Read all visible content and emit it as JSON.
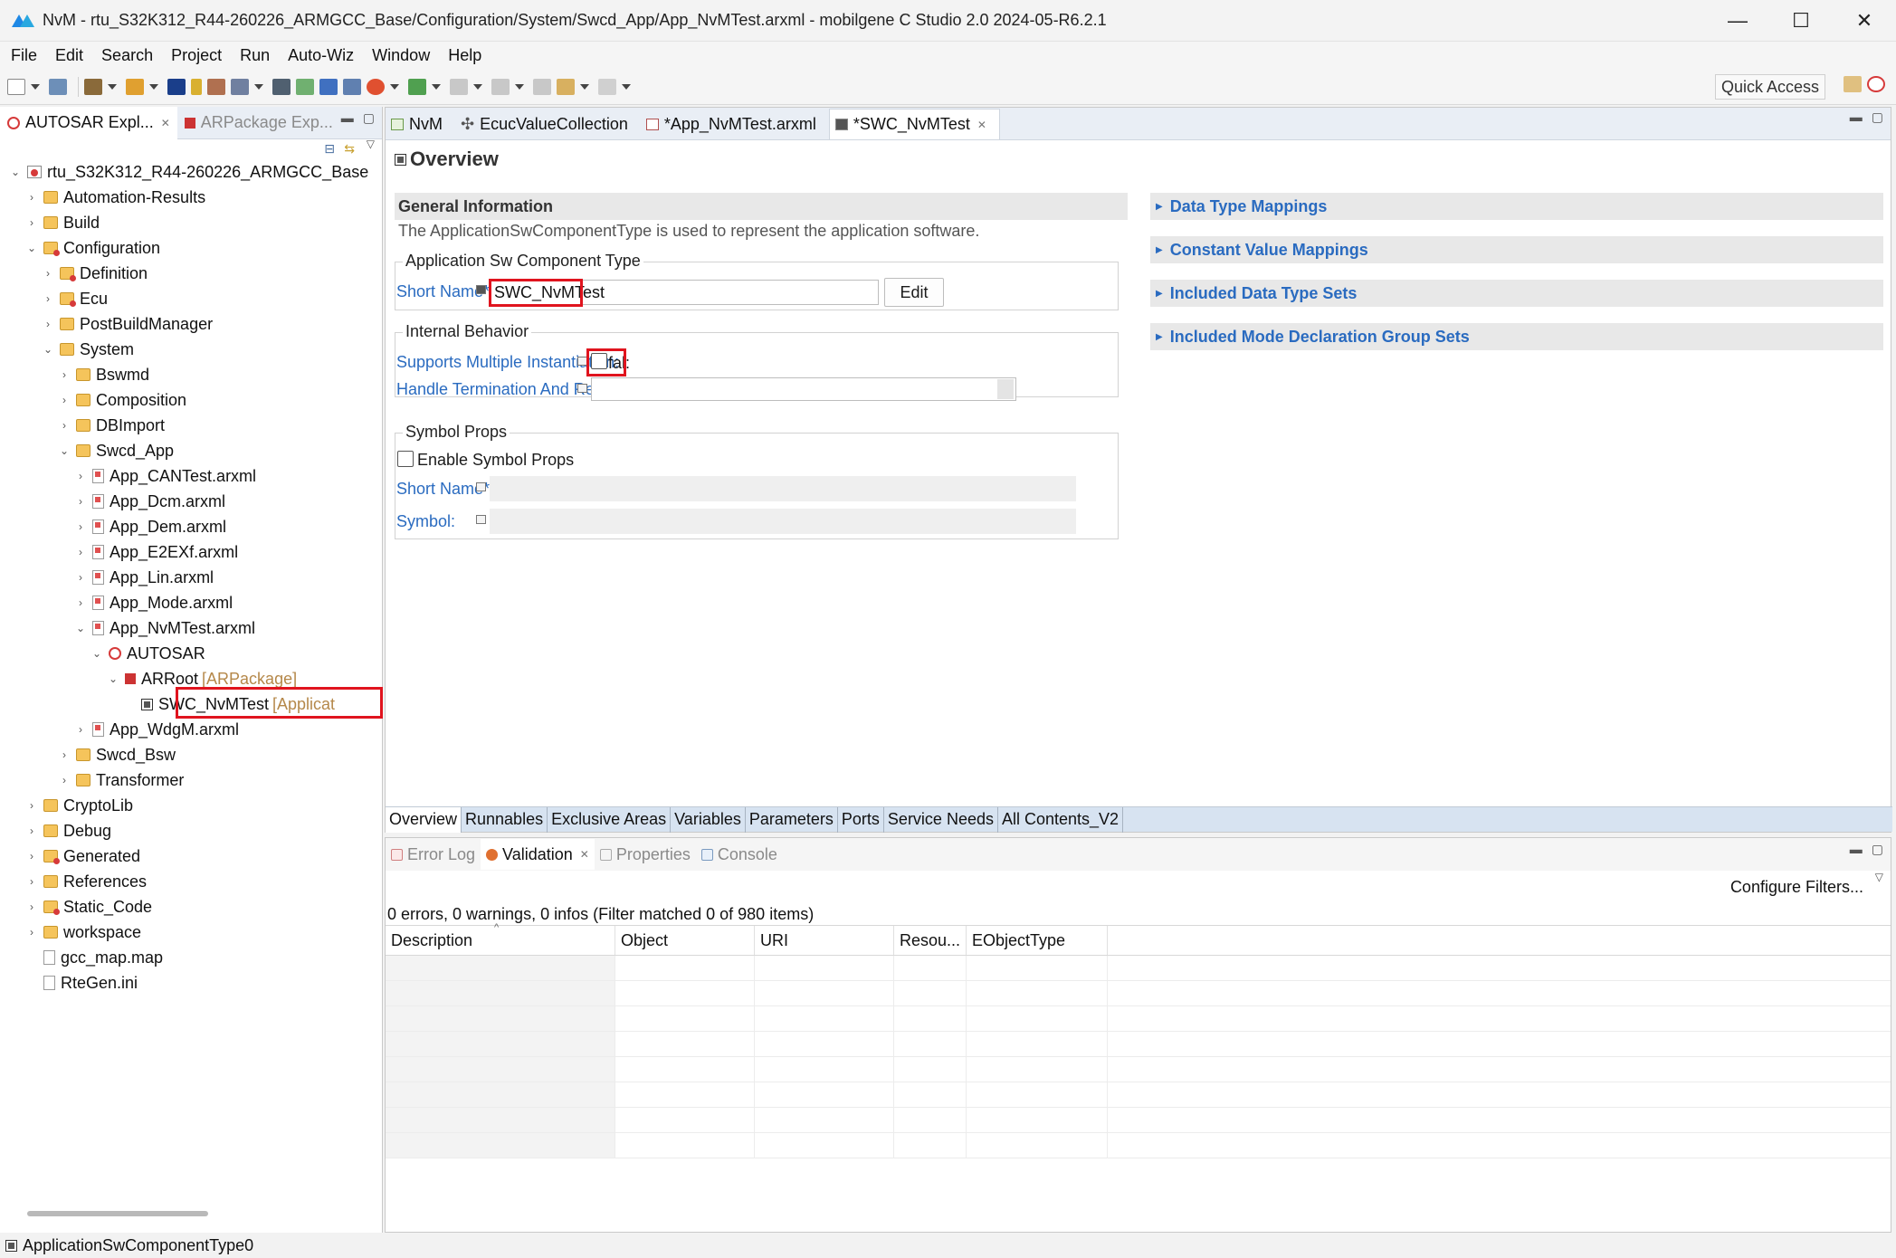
{
  "window": {
    "title": "NvM - rtu_S32K312_R44-260226_ARMGCC_Base/Configuration/System/Swcd_App/App_NvMTest.arxml - mobilgene C Studio 2.0 2024-05-R6.2.1",
    "minimize": "—",
    "maximize": "☐",
    "close": "✕"
  },
  "menu": [
    "File",
    "Edit",
    "Search",
    "Project",
    "Run",
    "Auto-Wiz",
    "Window",
    "Help"
  ],
  "toolbar": {
    "quick_access": "Quick Access"
  },
  "left_panel": {
    "tabs": [
      {
        "label": "AUTOSAR Expl...",
        "active": true
      },
      {
        "label": "ARPackage Exp...",
        "active": false
      }
    ],
    "tree": [
      {
        "label": "rtu_S32K312_R44-260226_ARMGCC_Base",
        "level": 0,
        "twisty": "v",
        "icon": "project"
      },
      {
        "label": "Automation-Results",
        "level": 1,
        "twisty": ">",
        "icon": "folder"
      },
      {
        "label": "Build",
        "level": 1,
        "twisty": ">",
        "icon": "folder"
      },
      {
        "label": "Configuration",
        "level": 1,
        "twisty": "v",
        "icon": "folder-red"
      },
      {
        "label": "Definition",
        "level": 2,
        "twisty": ">",
        "icon": "folder-red"
      },
      {
        "label": "Ecu",
        "level": 2,
        "twisty": ">",
        "icon": "folder-red"
      },
      {
        "label": "PostBuildManager",
        "level": 2,
        "twisty": ">",
        "icon": "folder"
      },
      {
        "label": "System",
        "level": 2,
        "twisty": "v",
        "icon": "folder"
      },
      {
        "label": "Bswmd",
        "level": 3,
        "twisty": ">",
        "icon": "folder"
      },
      {
        "label": "Composition",
        "level": 3,
        "twisty": ">",
        "icon": "folder"
      },
      {
        "label": "DBImport",
        "level": 3,
        "twisty": ">",
        "icon": "folder"
      },
      {
        "label": "Swcd_App",
        "level": 3,
        "twisty": "v",
        "icon": "folder"
      },
      {
        "label": "App_CANTest.arxml",
        "level": 4,
        "twisty": ">",
        "icon": "arxml"
      },
      {
        "label": "App_Dcm.arxml",
        "level": 4,
        "twisty": ">",
        "icon": "arxml"
      },
      {
        "label": "App_Dem.arxml",
        "level": 4,
        "twisty": ">",
        "icon": "arxml"
      },
      {
        "label": "App_E2EXf.arxml",
        "level": 4,
        "twisty": ">",
        "icon": "arxml"
      },
      {
        "label": "App_Lin.arxml",
        "level": 4,
        "twisty": ">",
        "icon": "arxml"
      },
      {
        "label": "App_Mode.arxml",
        "level": 4,
        "twisty": ">",
        "icon": "arxml"
      },
      {
        "label": "App_NvMTest.arxml",
        "level": 4,
        "twisty": "v",
        "icon": "arxml"
      },
      {
        "label": "AUTOSAR",
        "level": 5,
        "twisty": "v",
        "icon": "autosar"
      },
      {
        "label": "ARRoot",
        "level": 6,
        "twisty": "v",
        "icon": "package",
        "hint": "[ARPackage]"
      },
      {
        "label": "SWC_NvMTest",
        "level": 7,
        "twisty": "",
        "icon": "swc",
        "hint": "[Applicat"
      },
      {
        "label": "App_WdgM.arxml",
        "level": 4,
        "twisty": ">",
        "icon": "arxml"
      },
      {
        "label": "Swcd_Bsw",
        "level": 3,
        "twisty": ">",
        "icon": "folder"
      },
      {
        "label": "Transformer",
        "level": 3,
        "twisty": ">",
        "icon": "folder"
      },
      {
        "label": "CryptoLib",
        "level": 1,
        "twisty": ">",
        "icon": "folder"
      },
      {
        "label": "Debug",
        "level": 1,
        "twisty": ">",
        "icon": "folder"
      },
      {
        "label": "Generated",
        "level": 1,
        "twisty": ">",
        "icon": "folder-red"
      },
      {
        "label": "References",
        "level": 1,
        "twisty": ">",
        "icon": "folder"
      },
      {
        "label": "Static_Code",
        "level": 1,
        "twisty": ">",
        "icon": "folder-red"
      },
      {
        "label": "workspace",
        "level": 1,
        "twisty": ">",
        "icon": "folder"
      },
      {
        "label": "gcc_map.map",
        "level": 1,
        "twisty": "",
        "icon": "file"
      },
      {
        "label": "RteGen.ini",
        "level": 1,
        "twisty": "",
        "icon": "file"
      }
    ]
  },
  "editor": {
    "tabs": [
      {
        "label": "NvM",
        "active": false
      },
      {
        "label": "EcucValueCollection",
        "active": false
      },
      {
        "label": "*App_NvMTest.arxml",
        "active": false
      },
      {
        "label": "*SWC_NvMTest",
        "active": true
      }
    ],
    "overview_title": "Overview",
    "general_information": {
      "heading": "General Information",
      "description": "The ApplicationSwComponentType is used to represent the application software.",
      "group_label": "Application Sw Component Type",
      "short_name_label": "Short Name*:",
      "short_name_value": "SWC_NvMTest",
      "edit_button": "Edit"
    },
    "internal_behavior": {
      "group_label": "Internal Behavior",
      "supports_multiple_label": "Supports Multiple Instantiation:",
      "supports_multiple_value": "fal:",
      "handle_termination_label": "Handle Termination And Restart:"
    },
    "symbol_props": {
      "group_label": "Symbol Props",
      "enable_label": "Enable Symbol Props",
      "short_name_label": "Short Name*:",
      "symbol_label": "Symbol:"
    },
    "right_sections": [
      "Data Type Mappings",
      "Constant Value Mappings",
      "Included Data Type Sets",
      "Included Mode Declaration Group Sets"
    ],
    "page_tabs": [
      {
        "label": "Overview",
        "active": true
      },
      {
        "label": "Runnables",
        "active": false
      },
      {
        "label": "Exclusive Areas",
        "active": false
      },
      {
        "label": "Variables",
        "active": false
      },
      {
        "label": "Parameters",
        "active": false
      },
      {
        "label": "Ports",
        "active": false
      },
      {
        "label": "Service Needs",
        "active": false
      },
      {
        "label": "All Contents_V2",
        "active": false
      }
    ]
  },
  "bottom_panel": {
    "tabs": [
      {
        "label": "Error Log",
        "active": false
      },
      {
        "label": "Validation",
        "active": true
      },
      {
        "label": "Properties",
        "active": false
      },
      {
        "label": "Console",
        "active": false
      }
    ],
    "configure_filters": "Configure Filters...",
    "summary": "0 errors, 0 warnings, 0 infos (Filter matched 0 of 980 items)",
    "columns": [
      "Description",
      "Object",
      "URI",
      "Resou...",
      "EObjectType"
    ]
  },
  "status_bar": {
    "text": "ApplicationSwComponentType0"
  },
  "colors": {
    "highlight": "#e0141e",
    "link_blue": "#2a6bc0",
    "tab_bar": "#e9eef5"
  }
}
